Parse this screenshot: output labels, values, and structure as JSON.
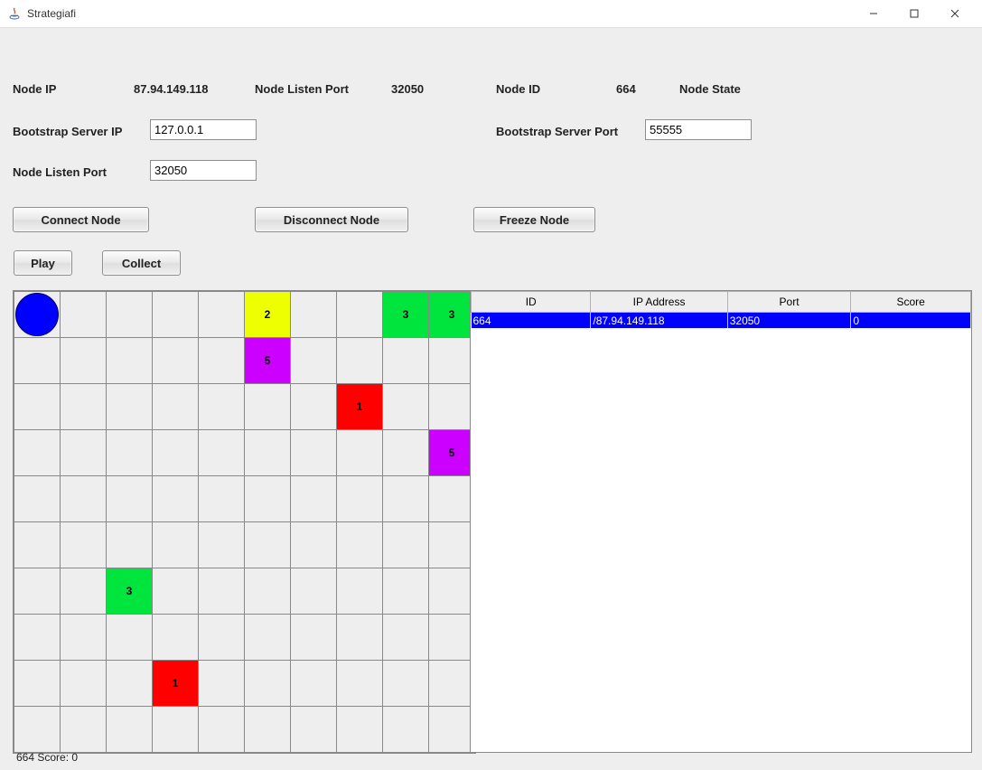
{
  "window": {
    "title": "Strategiafi",
    "minimize_icon": "minimize-icon",
    "maximize_icon": "maximize-icon",
    "close_icon": "close-icon"
  },
  "info": {
    "node_ip_label": "Node IP",
    "node_ip_value": "87.94.149.118",
    "node_listen_port_label": "Node Listen Port",
    "node_listen_port_value": "32050",
    "node_id_label": "Node ID",
    "node_id_value": "664",
    "node_state_label": "Node State"
  },
  "form": {
    "bsip_label": "Bootstrap Server IP",
    "bsip_value": "127.0.0.1",
    "bsport_label": "Bootstrap Server Port",
    "bsport_value": "55555",
    "nlp_label": "Node Listen Port",
    "nlp_value": "32050"
  },
  "buttons": {
    "connect": "Connect Node",
    "disconnect": "Disconnect Node",
    "freeze": "Freeze Node",
    "play": "Play",
    "collect": "Collect"
  },
  "grid": {
    "rows": 10,
    "cols": 10,
    "player": {
      "row": 0,
      "col": 0
    },
    "cells": [
      {
        "row": 0,
        "col": 5,
        "color": "#edff00",
        "value": "2"
      },
      {
        "row": 0,
        "col": 8,
        "color": "#00e53d",
        "value": "3"
      },
      {
        "row": 0,
        "col": 9,
        "color": "#00e53d",
        "value": "3"
      },
      {
        "row": 1,
        "col": 5,
        "color": "#cc00ff",
        "value": "5"
      },
      {
        "row": 2,
        "col": 7,
        "color": "#ff0000",
        "value": "1"
      },
      {
        "row": 3,
        "col": 9,
        "color": "#cc00ff",
        "value": "5"
      },
      {
        "row": 6,
        "col": 2,
        "color": "#00e53d",
        "value": "3"
      },
      {
        "row": 8,
        "col": 3,
        "color": "#ff0000",
        "value": "1"
      }
    ]
  },
  "score_label": "664 Score: 0",
  "table": {
    "headers": [
      "ID",
      "IP Address",
      "Port",
      "Score"
    ],
    "rows": [
      {
        "id": "664",
        "ip": "/87.94.149.118",
        "port": "32050",
        "score": "0",
        "selected": true
      }
    ]
  }
}
